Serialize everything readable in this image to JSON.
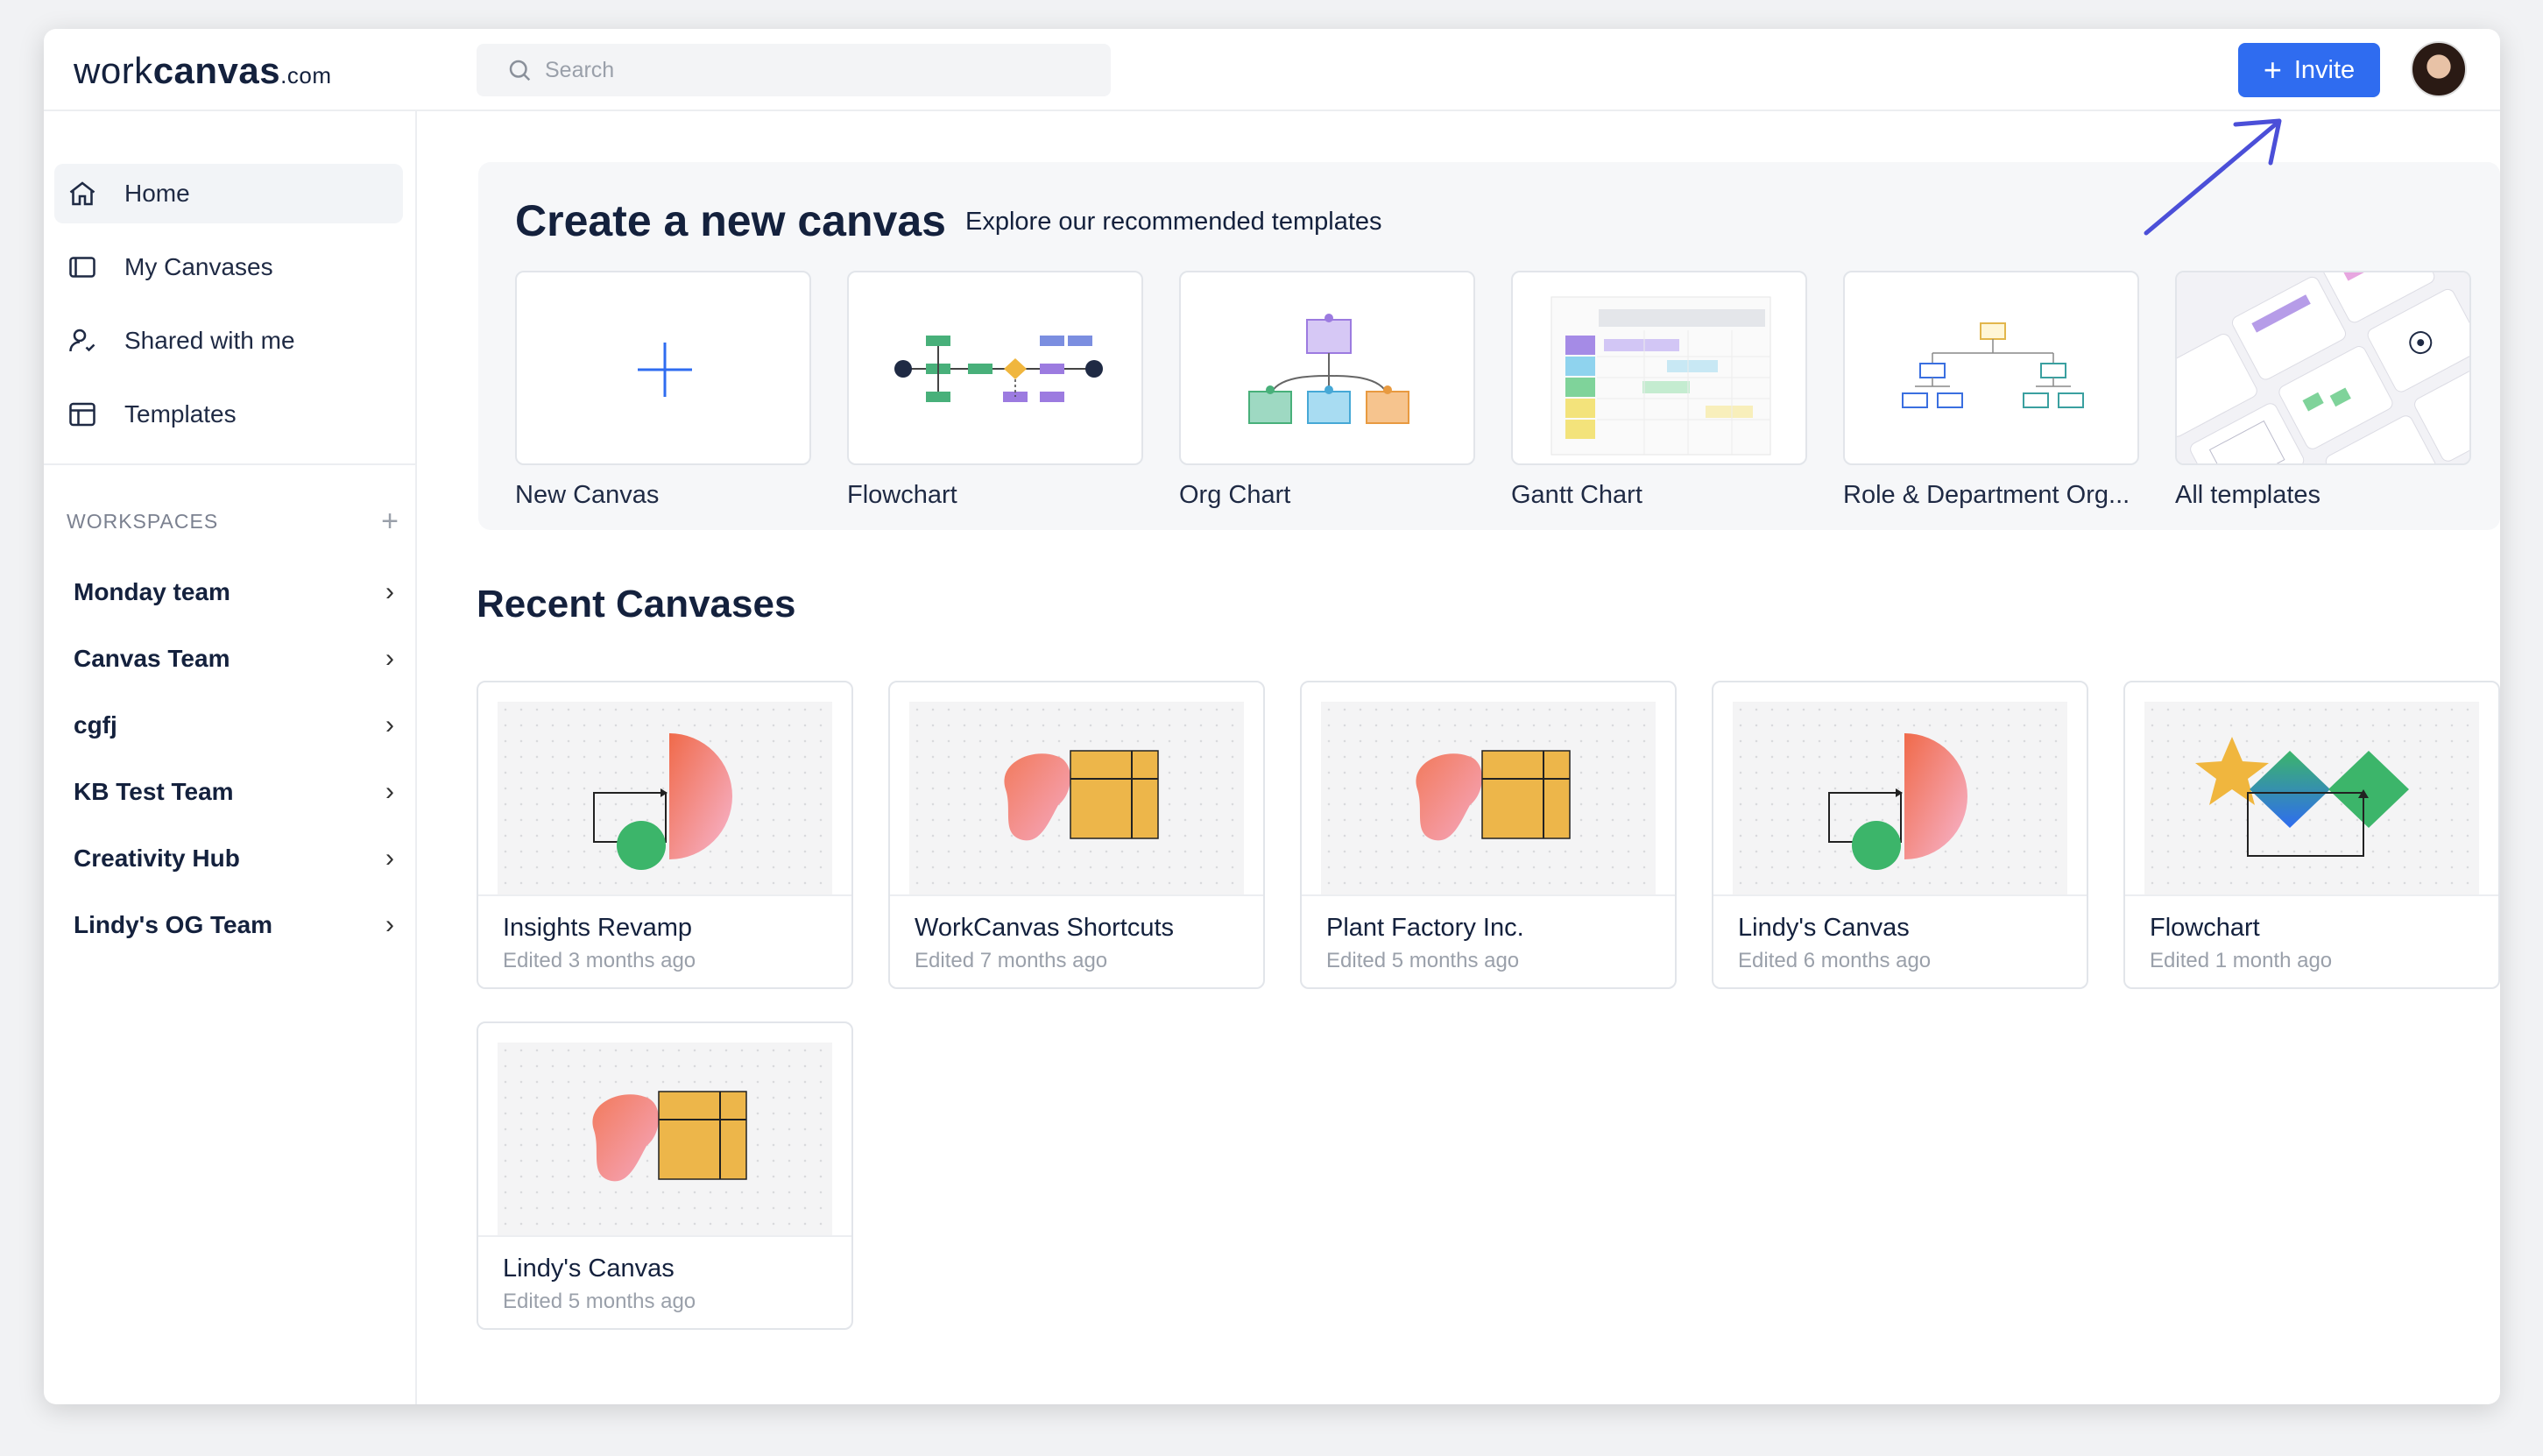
{
  "app": {
    "logo_word1": "work",
    "logo_word2": "canvas",
    "logo_domain": ".com"
  },
  "search": {
    "placeholder": "Search"
  },
  "header": {
    "invite_label": "Invite"
  },
  "nav": {
    "home": "Home",
    "my_canvases": "My Canvases",
    "shared": "Shared with me",
    "templates": "Templates"
  },
  "workspaces": {
    "heading": "WORKSPACES",
    "items": [
      "Monday team",
      "Canvas Team",
      "cgfj",
      "KB Test Team",
      "Creativity Hub",
      "Lindy's OG Team"
    ]
  },
  "create": {
    "title": "Create a new canvas",
    "subtitle": "Explore our recommended templates",
    "templates": [
      "New Canvas",
      "Flowchart",
      "Org Chart",
      "Gantt Chart",
      "Role & Department Org...",
      "All templates"
    ]
  },
  "recent": {
    "title": "Recent Canvases",
    "items": [
      {
        "name": "Insights Revamp",
        "meta": "Edited 3 months ago"
      },
      {
        "name": "WorkCanvas Shortcuts",
        "meta": "Edited 7 months ago"
      },
      {
        "name": "Plant Factory Inc.",
        "meta": "Edited 5 months ago"
      },
      {
        "name": "Lindy's Canvas",
        "meta": "Edited 6 months ago"
      },
      {
        "name": "Flowchart",
        "meta": "Edited 1 month ago"
      },
      {
        "name": "Lindy's Canvas",
        "meta": "Edited 5 months ago"
      }
    ]
  },
  "colors": {
    "accent": "#2f6cf0",
    "annotation_arrow": "#4b4fd8"
  }
}
